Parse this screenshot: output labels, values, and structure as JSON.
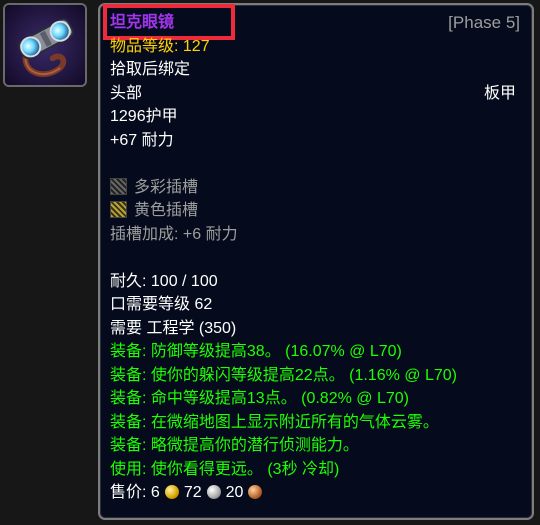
{
  "item": {
    "name": "坦克眼镜",
    "phase": "[Phase 5]",
    "item_level": "物品等级: 127",
    "bind": "拾取后绑定",
    "slot": "头部",
    "armor_type": "板甲",
    "armor": "1296护甲",
    "stamina": "+67 耐力",
    "sockets": [
      {
        "label": "多彩插槽",
        "icon": "meta-socket-icon"
      },
      {
        "label": "黄色插槽",
        "icon": "yellow-socket-icon"
      }
    ],
    "socket_bonus": "插槽加成: +6 耐力",
    "durability": "耐久: 100 / 100",
    "req_level": "口需要等级 62",
    "req_profession": "需要 工程学 (350)",
    "effects": [
      "装备: 防御等级提高38。 (16.07% @ L70)",
      "装备: 使你的躲闪等级提高22点。 (1.16% @ L70)",
      "装备: 命中等级提高13点。 (0.82% @ L70)",
      "装备:  在微缩地图上显示附近所有的气体云雾。",
      "装备:  略微提高你的潜行侦测能力。",
      "使用: 使你看得更远。 (3秒 冷却)"
    ],
    "sell_price": {
      "label": "售价:",
      "gold": "6",
      "silver": "72",
      "copper": "20"
    }
  },
  "colors": {
    "epic": "#a335ee",
    "effect": "#1eff00",
    "gray": "#9d9d9d",
    "item_level": "#ffd200",
    "highlight_box": "#ee2b3d"
  }
}
